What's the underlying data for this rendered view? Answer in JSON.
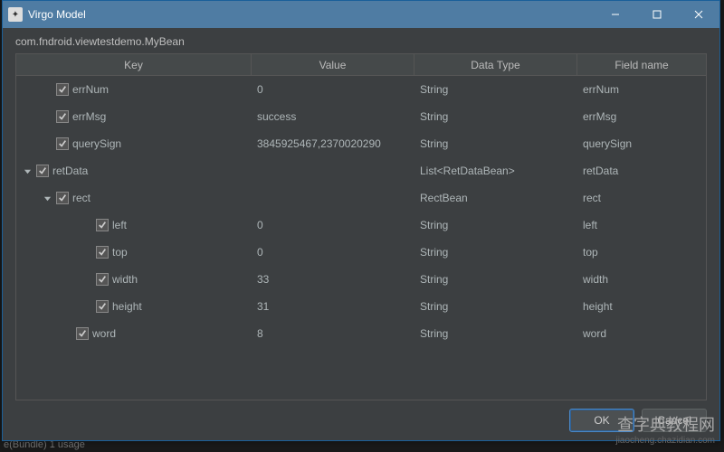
{
  "window": {
    "title": "Virgo Model"
  },
  "subhead": "com.fndroid.viewtestdemo.MyBean",
  "columns": {
    "key": "Key",
    "value": "Value",
    "type": "Data Type",
    "field": "Field name"
  },
  "rows": [
    {
      "indent": 1,
      "expander": "",
      "key": "errNum",
      "value": "0",
      "type": "String",
      "field": "errNum"
    },
    {
      "indent": 1,
      "expander": "",
      "key": "errMsg",
      "value": "success",
      "type": "String",
      "field": "errMsg"
    },
    {
      "indent": 1,
      "expander": "",
      "key": "querySign",
      "value": "3845925467,2370020290",
      "type": "String",
      "field": "querySign"
    },
    {
      "indent": 0,
      "expander": "down",
      "key": "retData",
      "value": "",
      "type": "List<RetDataBean>",
      "field": "retData"
    },
    {
      "indent": 1,
      "expander": "down",
      "key": "rect",
      "value": "",
      "type": "RectBean",
      "field": "rect"
    },
    {
      "indent": 3,
      "expander": "",
      "key": "left",
      "value": "0",
      "type": "String",
      "field": "left"
    },
    {
      "indent": 3,
      "expander": "",
      "key": "top",
      "value": "0",
      "type": "String",
      "field": "top"
    },
    {
      "indent": 3,
      "expander": "",
      "key": "width",
      "value": "33",
      "type": "String",
      "field": "width"
    },
    {
      "indent": 3,
      "expander": "",
      "key": "height",
      "value": "31",
      "type": "String",
      "field": "height"
    },
    {
      "indent": 2,
      "expander": "",
      "key": "word",
      "value": "8",
      "type": "String",
      "field": "word"
    }
  ],
  "buttons": {
    "ok": "OK",
    "cancel": "Cancel"
  },
  "watermark": {
    "cn": "查字典教程网",
    "url": "jiaocheng.chazidian.com"
  },
  "bg_hint": "e(Bundle)   1 usage"
}
